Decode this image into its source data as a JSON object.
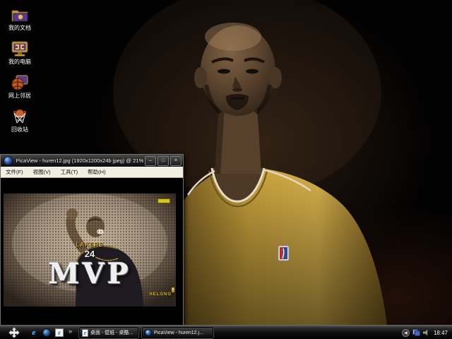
{
  "desktop": {
    "icons": [
      {
        "label": "我的文档",
        "icon": "my-documents-icon"
      },
      {
        "label": "我的电脑",
        "icon": "my-computer-icon"
      },
      {
        "label": "网上邻居",
        "icon": "network-places-icon"
      },
      {
        "label": "回收站",
        "icon": "recycle-bin-icon"
      }
    ]
  },
  "viewer_window": {
    "title": "PicaView - huren12.jpg (1920x1200x24b jpeg) @ 21%",
    "menu_items": [
      "文件(F)",
      "视图(V)",
      "工具(T)",
      "帮助(H)"
    ],
    "controls": {
      "minimize": "–",
      "maximize": "□",
      "close": "×"
    },
    "image": {
      "caption": "MVP",
      "jersey_text": "LAKERS",
      "jersey_number": "24",
      "watermark": "HELONG"
    }
  },
  "taskbar": {
    "quick_launch_chevron": "»",
    "quick_launch_e": "e",
    "tasks": [
      {
        "label": "桌面 - 壁纸 - 桌酷...",
        "icon": "ie-document-icon"
      },
      {
        "label": "PicaView - huren12.j...",
        "icon": "picaview-icon"
      }
    ],
    "tray_chevron": "◀",
    "clock": "18:47"
  },
  "colors": {
    "jersey_gold": "#c9a23c",
    "accent_yellow": "#d6c41e",
    "taskbar_black": "#0d0d0d"
  }
}
